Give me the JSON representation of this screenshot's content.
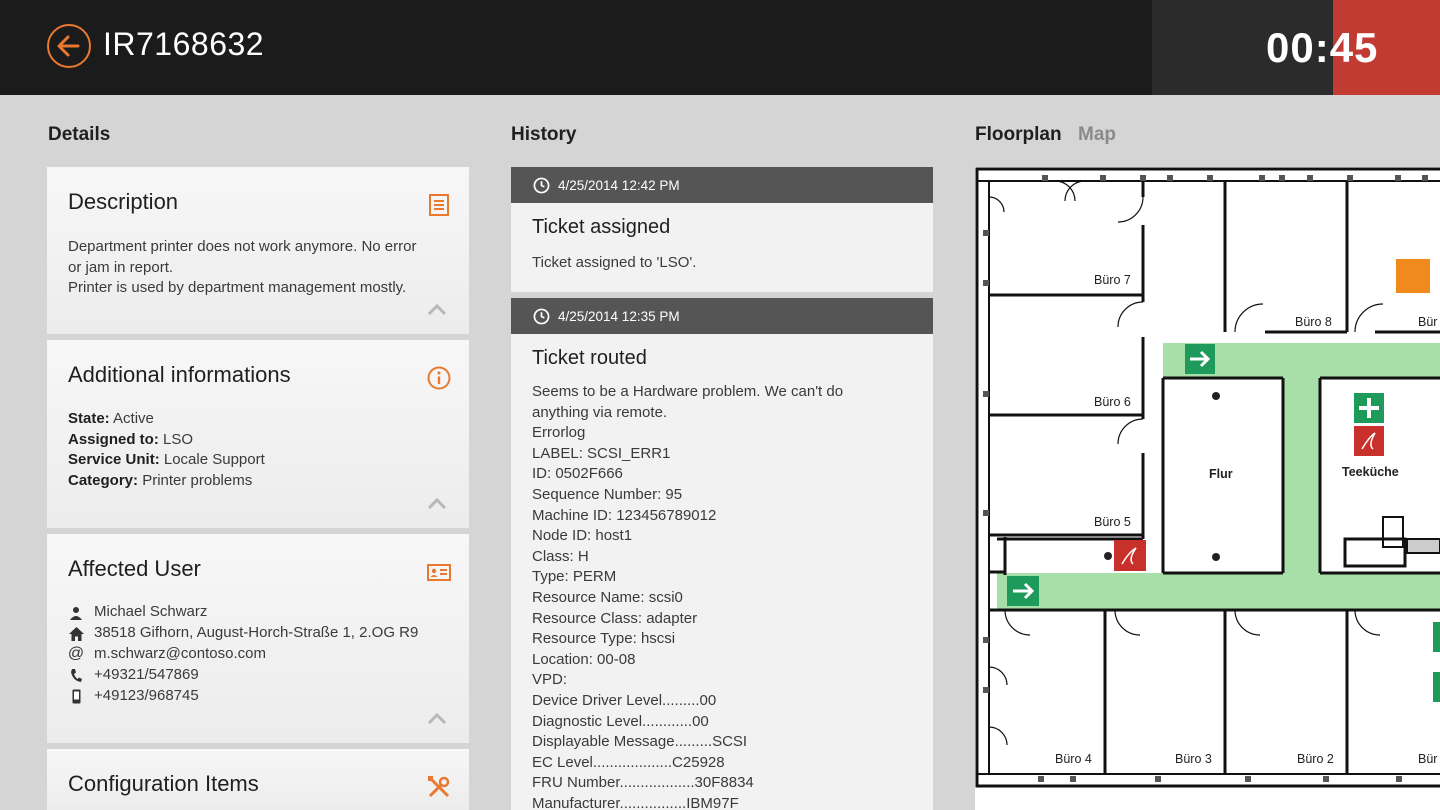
{
  "header": {
    "title": "IR7168632",
    "timer": "00:45"
  },
  "sections": {
    "details": "Details",
    "history": "History",
    "floorplan_tab": "Floorplan",
    "map_tab": "Map"
  },
  "description": {
    "title": "Description",
    "lines": [
      "Department printer does not work anymore. No error",
      "or jam in report.",
      "Printer is used by department management mostly."
    ]
  },
  "additional": {
    "title": "Additional informations",
    "rows": [
      {
        "key": "State:",
        "value": "Active"
      },
      {
        "key": "Assigned to:",
        "value": "LSO"
      },
      {
        "key": "Service Unit:",
        "value": "Locale Support"
      },
      {
        "key": "Category:",
        "value": "Printer problems"
      }
    ]
  },
  "affected_user": {
    "title": "Affected User",
    "name": "Michael Schwarz",
    "address": "38518 Gifhorn, August-Horch-Straße 1, 2.OG R9",
    "email": "m.schwarz@contoso.com",
    "phone": "+49321/547869",
    "mobile": "+49123/968745"
  },
  "config_items": {
    "title": "Configuration Items"
  },
  "history": [
    {
      "timestamp": "4/25/2014 12:42 PM",
      "title": "Ticket assigned",
      "text": "Ticket assigned to 'LSO'."
    },
    {
      "timestamp": "4/25/2014 12:35 PM",
      "title": "Ticket routed",
      "text": "Seems to be a Hardware problem. We can't do\nanything via remote.\nErrorlog\nLABEL: SCSI_ERR1\nID: 0502F666\nSequence Number: 95\nMachine ID: 123456789012\nNode ID: host1\nClass: H\nType: PERM\nResource Name: scsi0\nResource Class: adapter\nResource Type: hscsi\nLocation: 00-08\nVPD:\nDevice Driver Level.........00\nDiagnostic Level............00\nDisplayable Message.........SCSI\nEC Level...................C25928\nFRU Number..................30F8834\nManufacturer................IBM97F"
    }
  ],
  "floorplan": {
    "rooms": [
      "Büro 7",
      "Büro 8",
      "Bür",
      "Büro 6",
      "Flur",
      "Teeküche",
      "Büro 5",
      "Büro 4",
      "Büro 3",
      "Büro 2",
      "Bür"
    ]
  },
  "colors": {
    "accent": "#e8792e",
    "timer_red": "#c23b32",
    "corridor": "#a8dfa8",
    "exit_sign": "#1e9a5a",
    "alarm": "#c8302c"
  }
}
